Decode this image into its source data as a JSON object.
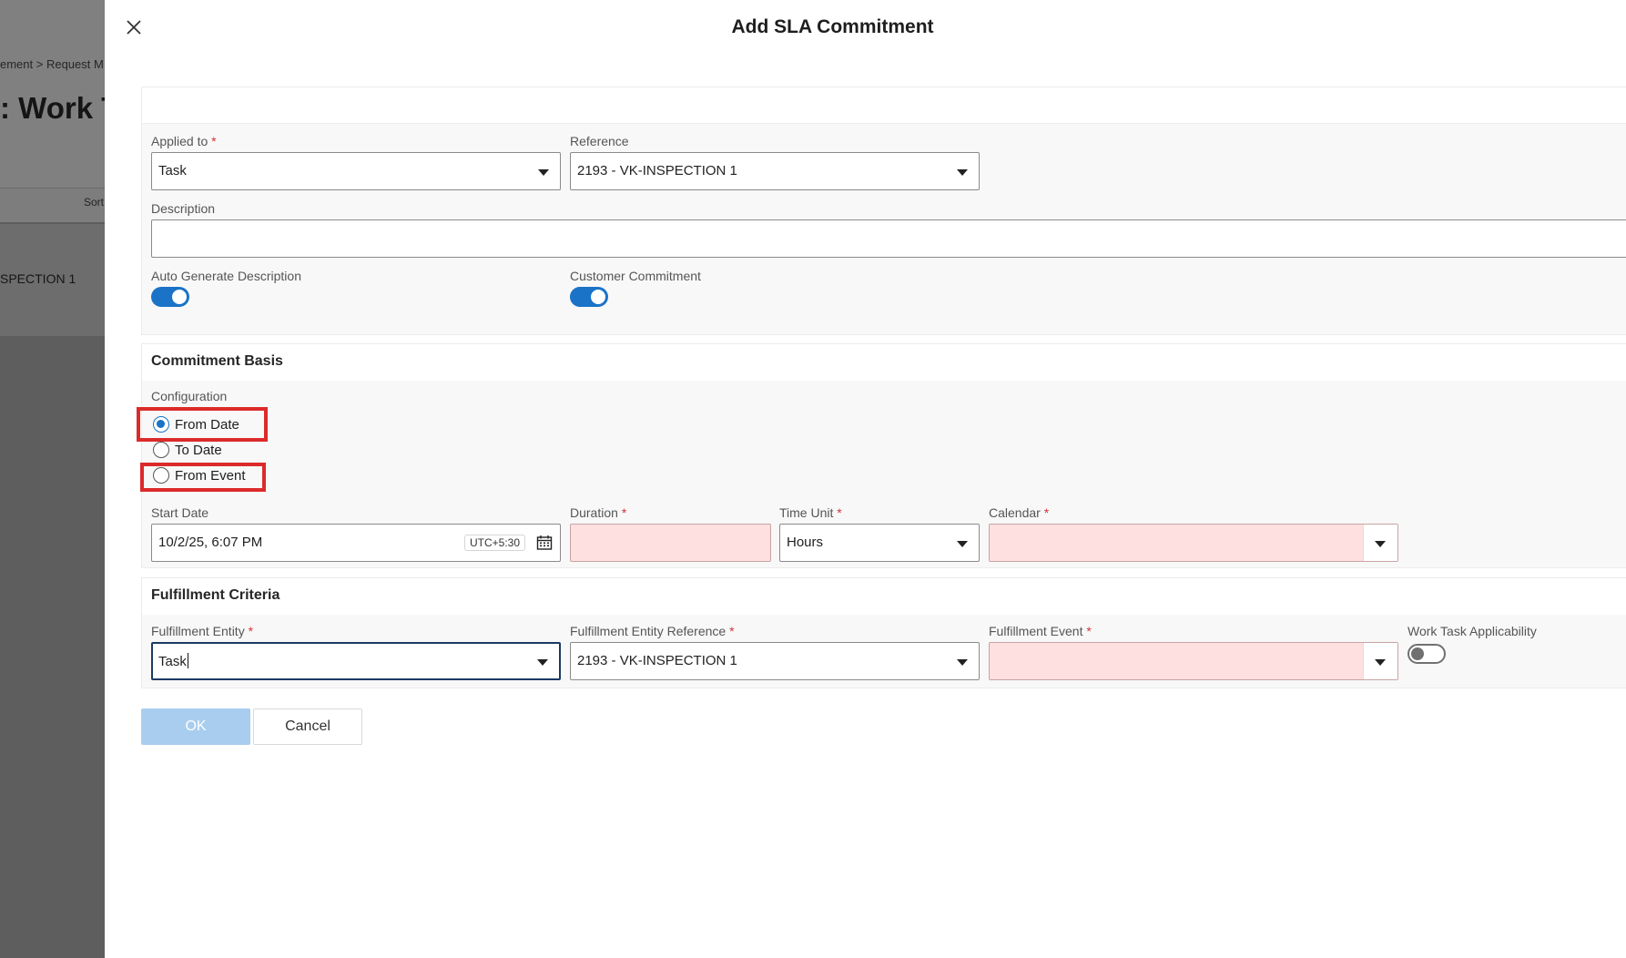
{
  "background": {
    "breadcrumb": "ement  >  Request M",
    "title": ": Work T",
    "sort_label": "Sort",
    "row_label": "SPECTION 1"
  },
  "dialog": {
    "title": "Add SLA Commitment"
  },
  "general": {
    "applied_to_label": "Applied to",
    "applied_to_value": "Task",
    "reference_label": "Reference",
    "reference_value": "2193 - VK-INSPECTION 1",
    "description_label": "Description",
    "description_value": "",
    "auto_generate_label": "Auto Generate Description",
    "auto_generate_on": true,
    "customer_commitment_label": "Customer Commitment",
    "customer_commitment_on": true
  },
  "commitment_basis": {
    "title": "Commitment Basis",
    "configuration_label": "Configuration",
    "options": [
      "From Date",
      "To Date",
      "From Event"
    ],
    "selected": "From Date",
    "start_date_label": "Start Date",
    "start_date_value": "10/2/25, 6:07 PM",
    "timezone": "UTC+5:30",
    "duration_label": "Duration",
    "duration_value": "",
    "time_unit_label": "Time Unit",
    "time_unit_value": "Hours",
    "calendar_label": "Calendar",
    "calendar_value": ""
  },
  "fulfillment": {
    "title": "Fulfillment Criteria",
    "entity_label": "Fulfillment Entity",
    "entity_value": "Task",
    "entity_reference_label": "Fulfillment Entity Reference",
    "entity_reference_value": "2193 - VK-INSPECTION 1",
    "event_label": "Fulfillment Event",
    "event_value": "",
    "work_task_label": "Work Task Applicability",
    "work_task_on": false
  },
  "buttons": {
    "ok": "OK",
    "cancel": "Cancel"
  },
  "colors": {
    "accent": "#1a73c7",
    "error_field": "#fde0df",
    "highlight": "#dc2a2a",
    "ok_disabled": "#a9cdee"
  },
  "required_marker": "*"
}
